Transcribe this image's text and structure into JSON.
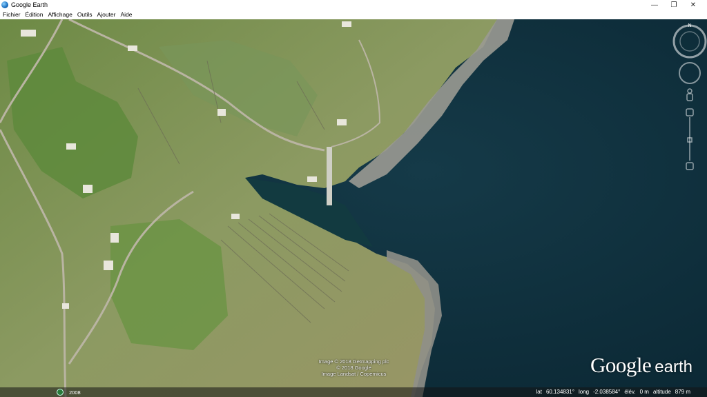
{
  "window": {
    "title": "Google Earth",
    "minimize_glyph": "—",
    "maximize_glyph": "❐",
    "close_glyph": "✕"
  },
  "menu": {
    "items": [
      "Fichier",
      "Édition",
      "Affichage",
      "Outils",
      "Ajouter",
      "Aide"
    ]
  },
  "navigation": {
    "compass_label": "N",
    "icons": [
      "compass-ring-icon",
      "look-joystick-icon",
      "pegman-icon",
      "zoom-slider-icon"
    ]
  },
  "map": {
    "attribution": [
      "Image © 2018 Getmapping plc",
      "© 2018 Google",
      "Image Landsat / Copernicus"
    ],
    "logo_google": "Google",
    "logo_earth": "earth",
    "colors": {
      "sea": "#0e2f3c",
      "land": "#8c9a62",
      "grass": "#5e8a3c",
      "cliff": "#9a9a92"
    }
  },
  "status": {
    "year": "2008",
    "lat_label": "lat",
    "lat_value": "60.134831°",
    "long_label": "long",
    "long_value": "-2.038584°",
    "elev_label": "élév.",
    "elev_value": "0 m",
    "alt_label": "altitude",
    "alt_value": "879 m"
  }
}
